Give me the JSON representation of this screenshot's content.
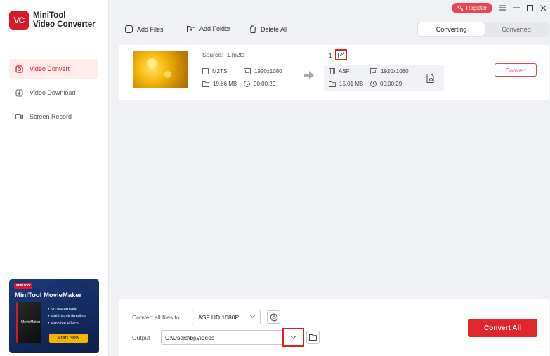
{
  "app": {
    "logo_text": "VC",
    "name_line1": "MiniTool",
    "name_line2": "Video Converter"
  },
  "titlebar": {
    "register_label": "Register"
  },
  "sidebar": {
    "items": [
      {
        "label": "Video Convert",
        "icon": "video-convert-icon",
        "active": true
      },
      {
        "label": "Video Download",
        "icon": "download-icon",
        "active": false
      },
      {
        "label": "Screen Record",
        "icon": "camera-icon",
        "active": false
      }
    ],
    "promo": {
      "badge": "MiniTool",
      "title": "MiniTool MovieMaker",
      "box_label": "MovieMaker",
      "features": [
        "No watermark",
        "Multi-track timeline",
        "Massive effects"
      ],
      "button": "Start Now"
    }
  },
  "toolbar": {
    "add_files": "Add Files",
    "add_folder": "Add Folder",
    "delete_all": "Delete All"
  },
  "tabs": {
    "converting": "Converting",
    "converted": "Converted"
  },
  "file": {
    "source_label": "Source:",
    "source_name": "1.m2ts",
    "format": "M2TS",
    "resolution": "1920x1080",
    "size": "19.86 MB",
    "duration": "00:00:29"
  },
  "target": {
    "index": "1",
    "format": "ASF",
    "resolution": "1920x1080",
    "size": "15.01 MB",
    "duration": "00:00:29"
  },
  "convert_label": "Convert",
  "bottom": {
    "convert_all_to_label": "Convert all files to",
    "format_value": "ASF HD 1080P",
    "output_label": "Output",
    "output_path": "C:\\Users\\bj\\Videos",
    "convert_all_label": "Convert All"
  },
  "colors": {
    "accent": "#e0252b",
    "highlight": "#e02020"
  }
}
